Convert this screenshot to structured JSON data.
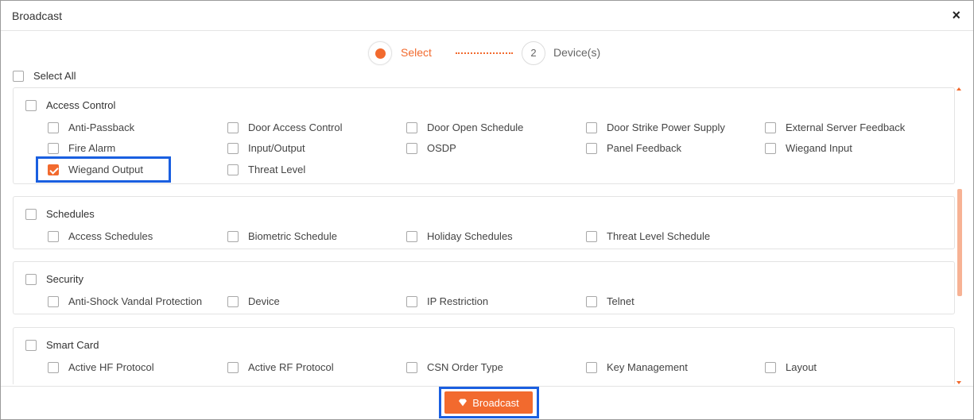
{
  "dialog": {
    "title": "Broadcast",
    "close": "×"
  },
  "stepper": {
    "step1_label": "Select",
    "step2_number": "2",
    "step2_label": "Device(s)"
  },
  "select_all_label": "Select All",
  "groups": [
    {
      "label": "Access Control",
      "items": [
        {
          "label": "Anti-Passback",
          "checked": false
        },
        {
          "label": "Door Access Control",
          "checked": false
        },
        {
          "label": "Door Open Schedule",
          "checked": false
        },
        {
          "label": "Door Strike Power Supply",
          "checked": false
        },
        {
          "label": "External Server Feedback",
          "checked": false
        },
        {
          "label": "Fire Alarm",
          "checked": false
        },
        {
          "label": "Input/Output",
          "checked": false
        },
        {
          "label": "OSDP",
          "checked": false
        },
        {
          "label": "Panel Feedback",
          "checked": false
        },
        {
          "label": "Wiegand Input",
          "checked": false
        },
        {
          "label": "Wiegand Output",
          "checked": true
        },
        {
          "label": "Threat Level",
          "checked": false
        }
      ]
    },
    {
      "label": "Schedules",
      "items": [
        {
          "label": "Access Schedules",
          "checked": false
        },
        {
          "label": "Biometric Schedule",
          "checked": false
        },
        {
          "label": "Holiday Schedules",
          "checked": false
        },
        {
          "label": "Threat Level Schedule",
          "checked": false
        }
      ]
    },
    {
      "label": "Security",
      "items": [
        {
          "label": "Anti-Shock Vandal Protection",
          "checked": false
        },
        {
          "label": "Device",
          "checked": false
        },
        {
          "label": "IP Restriction",
          "checked": false
        },
        {
          "label": "Telnet",
          "checked": false
        }
      ]
    },
    {
      "label": "Smart Card",
      "items": [
        {
          "label": "Active HF Protocol",
          "checked": false
        },
        {
          "label": "Active RF Protocol",
          "checked": false
        },
        {
          "label": "CSN Order Type",
          "checked": false
        },
        {
          "label": "Key Management",
          "checked": false
        },
        {
          "label": "Layout",
          "checked": false
        }
      ]
    }
  ],
  "broadcast_button": "Broadcast",
  "colors": {
    "accent": "#f26a2e",
    "highlight": "#1a5fe0"
  },
  "icons": {
    "close": "close-icon",
    "broadcast": "broadcast-icon"
  }
}
